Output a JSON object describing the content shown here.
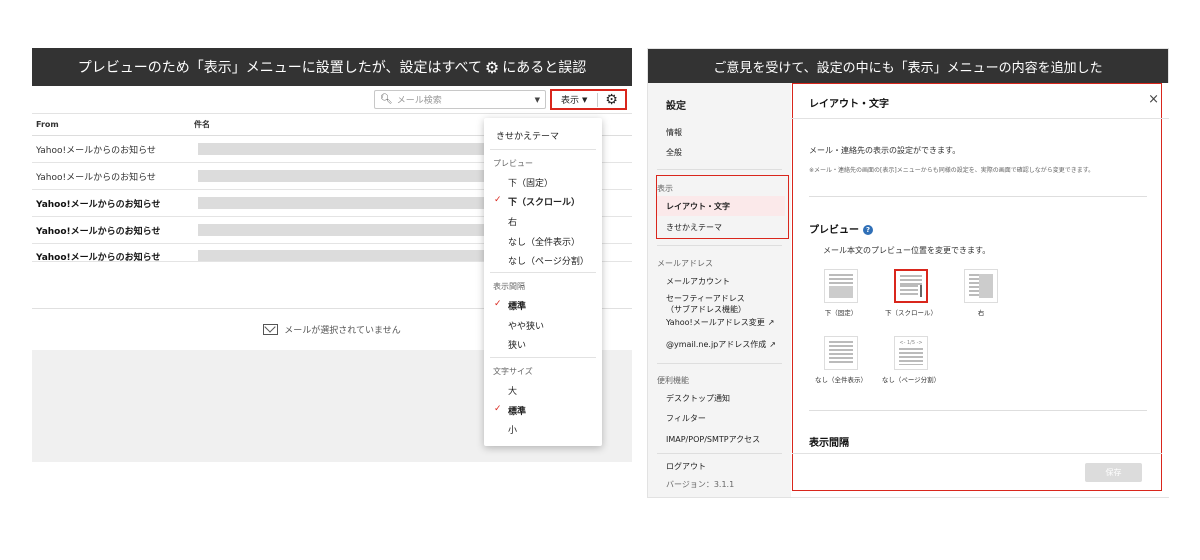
{
  "left_panel": {
    "banner": {
      "before_icon": "プレビューのため「表示」メニューに設置したが、設定はすべて",
      "icon": "gear-icon",
      "after_icon": "にあると誤認"
    },
    "toolbar": {
      "search_placeholder": "メール検索",
      "view_label": "表示"
    },
    "table": {
      "col_from": "From",
      "col_subject": "件名",
      "rows": [
        {
          "from": "Yahoo!メールからのお知らせ",
          "unread": false
        },
        {
          "from": "Yahoo!メールからのお知らせ",
          "unread": false
        },
        {
          "from": "Yahoo!メールからのお知らせ",
          "unread": true
        },
        {
          "from": "Yahoo!メールからのお知らせ",
          "unread": true
        },
        {
          "from": "Yahoo!メールからのお知らせ",
          "unread": true
        }
      ]
    },
    "no_selection": "メールが選択されていません",
    "dropdown": {
      "theme": "きせかえテーマ",
      "preview_head": "プレビュー",
      "preview_items": [
        "下（固定）",
        "下（スクロール）",
        "右",
        "なし（全件表示）",
        "なし（ページ分割）"
      ],
      "spacing_head": "表示間隔",
      "spacing_items": [
        "標準",
        "やや狭い",
        "狭い"
      ],
      "font_head": "文字サイズ",
      "font_items": [
        "大",
        "標準",
        "小"
      ]
    }
  },
  "right_panel": {
    "banner": "ご意見を受けて、設定の中にも「表示」メニューの内容を追加した",
    "sidebar": {
      "title": "設定",
      "info": "情報",
      "general": "全般",
      "display_head": "表示",
      "layout": "レイアウト・文字",
      "theme": "きせかえテーマ",
      "address_head": "メールアドレス",
      "account": "メールアカウント",
      "safety_1": "セーフティーアドレス",
      "safety_2": "（サブアドレス機能）",
      "change": "Yahoo!メールアドレス変更",
      "ymail": "@ymail.ne.jpアドレス作成",
      "features_head": "便利機能",
      "desktop": "デスクトップ通知",
      "filter": "フィルター",
      "imap": "IMAP/POP/SMTPアクセス",
      "logout": "ログアウト",
      "version": "バージョン：3.1.1"
    },
    "content": {
      "title": "レイアウト・文字",
      "close": "×",
      "desc": "メール・連絡先の表示の設定ができます。",
      "note": "※メール・連絡先の画面の[表示]メニューからも同様の設定を、実際の画面で確認しながら変更できます。",
      "preview_head": "プレビュー",
      "help": "?",
      "preview_sub": "メール本文のプレビュー位置を変更できます。",
      "options": [
        "下（固定）",
        "下（スクロール）",
        "右",
        "なし（全件表示）",
        "なし（ページ分割）"
      ],
      "pager_text": "<- 1/5 ->",
      "spacing_head": "表示間隔",
      "save": "保存"
    }
  },
  "colors": {
    "accent": "#d9261c",
    "banner": "#333333",
    "help": "#2f6fb7"
  }
}
